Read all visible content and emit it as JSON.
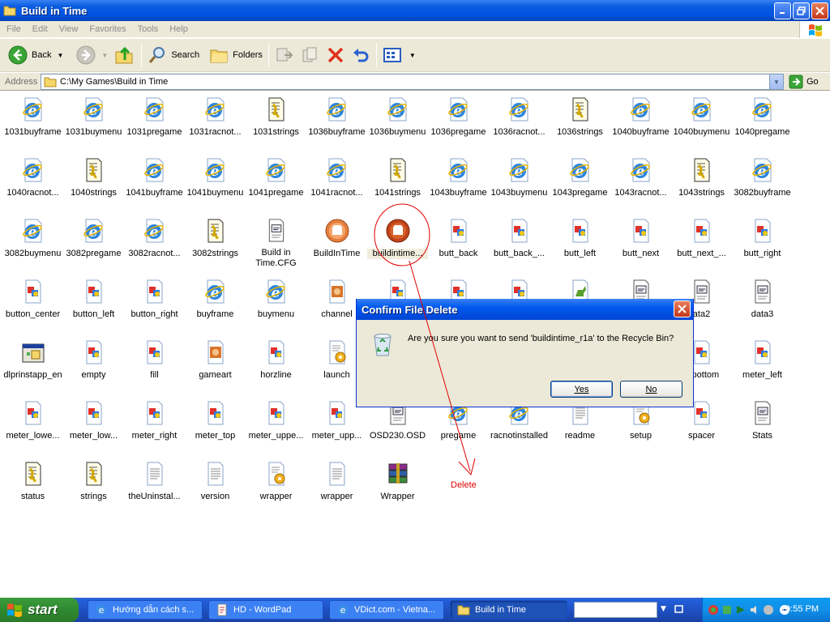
{
  "window": {
    "title": "Build in Time"
  },
  "menu": [
    "File",
    "Edit",
    "View",
    "Favorites",
    "Tools",
    "Help"
  ],
  "toolbar": {
    "back": "Back",
    "search": "Search",
    "folders": "Folders"
  },
  "address": {
    "label": "Address",
    "path": "C:\\My Games\\Build in Time",
    "go": "Go"
  },
  "files": [
    {
      "name": "1031buyframe",
      "icon": "ie-html"
    },
    {
      "name": "1031buymenu",
      "icon": "ie-html"
    },
    {
      "name": "1031pregame",
      "icon": "ie-html"
    },
    {
      "name": "1031racnot...",
      "icon": "ie-html"
    },
    {
      "name": "1031strings",
      "icon": "script-text"
    },
    {
      "name": "1036buyframe",
      "icon": "ie-html"
    },
    {
      "name": "1036buymenu",
      "icon": "ie-html"
    },
    {
      "name": "1036pregame",
      "icon": "ie-html"
    },
    {
      "name": "1036racnot...",
      "icon": "ie-html"
    },
    {
      "name": "1036strings",
      "icon": "script-text"
    },
    {
      "name": "1040buyframe",
      "icon": "ie-html"
    },
    {
      "name": "1040buymenu",
      "icon": "ie-html"
    },
    {
      "name": "1040pregame",
      "icon": "ie-html"
    },
    {
      "name": "1040racnot...",
      "icon": "ie-html"
    },
    {
      "name": "1040strings",
      "icon": "script-text"
    },
    {
      "name": "1041buyframe",
      "icon": "ie-html"
    },
    {
      "name": "1041buymenu",
      "icon": "ie-html"
    },
    {
      "name": "1041pregame",
      "icon": "ie-html"
    },
    {
      "name": "1041racnot...",
      "icon": "ie-html"
    },
    {
      "name": "1041strings",
      "icon": "script-text"
    },
    {
      "name": "1043buyframe",
      "icon": "ie-html"
    },
    {
      "name": "1043buymenu",
      "icon": "ie-html"
    },
    {
      "name": "1043pregame",
      "icon": "ie-html"
    },
    {
      "name": "1043racnot...",
      "icon": "ie-html"
    },
    {
      "name": "1043strings",
      "icon": "script-text"
    },
    {
      "name": "3082buyframe",
      "icon": "ie-html"
    },
    {
      "name": "3082buymenu",
      "icon": "ie-html"
    },
    {
      "name": "3082pregame",
      "icon": "ie-html"
    },
    {
      "name": "3082racnot...",
      "icon": "ie-html"
    },
    {
      "name": "3082strings",
      "icon": "script-text"
    },
    {
      "name": "Build in Time.CFG",
      "icon": "cfg-doc"
    },
    {
      "name": "BuildInTime",
      "icon": "app-orange"
    },
    {
      "name": "buildintime...",
      "icon": "app-orange-selected"
    },
    {
      "name": "butt_back",
      "icon": "image-doc"
    },
    {
      "name": "butt_back_...",
      "icon": "image-doc"
    },
    {
      "name": "butt_left",
      "icon": "image-doc"
    },
    {
      "name": "butt_next",
      "icon": "image-doc"
    },
    {
      "name": "butt_next_...",
      "icon": "image-doc"
    },
    {
      "name": "butt_right",
      "icon": "image-doc"
    },
    {
      "name": "button_center",
      "icon": "image-doc"
    },
    {
      "name": "button_left",
      "icon": "image-doc"
    },
    {
      "name": "button_right",
      "icon": "image-doc"
    },
    {
      "name": "buyframe",
      "icon": "ie-html"
    },
    {
      "name": "buymenu",
      "icon": "ie-html"
    },
    {
      "name": "channel",
      "icon": "media-doc"
    },
    {
      "name": "",
      "icon": "image-doc"
    },
    {
      "name": "",
      "icon": "image-doc"
    },
    {
      "name": "",
      "icon": "image-doc"
    },
    {
      "name": "",
      "icon": "dino-doc"
    },
    {
      "name": "",
      "icon": "cfg-doc"
    },
    {
      "name": "ata2",
      "icon": "cfg-doc"
    },
    {
      "name": "data3",
      "icon": "cfg-doc"
    },
    {
      "name": "dlprinstapp_en",
      "icon": "installer"
    },
    {
      "name": "empty",
      "icon": "image-doc"
    },
    {
      "name": "fill",
      "icon": "image-doc"
    },
    {
      "name": "gameart",
      "icon": "media-doc"
    },
    {
      "name": "horzline",
      "icon": "image-doc"
    },
    {
      "name": "launch",
      "icon": "settings-doc"
    },
    {
      "name": "",
      "icon": "blank"
    },
    {
      "name": "",
      "icon": "blank"
    },
    {
      "name": "",
      "icon": "blank"
    },
    {
      "name": "",
      "icon": "blank"
    },
    {
      "name": "",
      "icon": "blank"
    },
    {
      "name": "r_bottom",
      "icon": "image-doc"
    },
    {
      "name": "meter_left",
      "icon": "image-doc"
    },
    {
      "name": "meter_lowe...",
      "icon": "image-doc"
    },
    {
      "name": "meter_low...",
      "icon": "image-doc"
    },
    {
      "name": "meter_right",
      "icon": "image-doc"
    },
    {
      "name": "meter_top",
      "icon": "image-doc"
    },
    {
      "name": "meter_uppe...",
      "icon": "image-doc"
    },
    {
      "name": "meter_upp...",
      "icon": "image-doc"
    },
    {
      "name": "OSD230.OSD",
      "icon": "cfg-doc"
    },
    {
      "name": "pregame",
      "icon": "ie-html"
    },
    {
      "name": "racnotinstalled",
      "icon": "ie-html"
    },
    {
      "name": "readme",
      "icon": "text-doc"
    },
    {
      "name": "setup",
      "icon": "settings-doc"
    },
    {
      "name": "spacer",
      "icon": "image-doc"
    },
    {
      "name": "Stats",
      "icon": "cfg-doc"
    },
    {
      "name": "status",
      "icon": "script-text"
    },
    {
      "name": "strings",
      "icon": "script-text"
    },
    {
      "name": "theUninstal...",
      "icon": "text-doc"
    },
    {
      "name": "version",
      "icon": "text-doc"
    },
    {
      "name": "wrapper",
      "icon": "settings-doc"
    },
    {
      "name": "wrapper",
      "icon": "text-doc"
    },
    {
      "name": "Wrapper",
      "icon": "winrar"
    }
  ],
  "annotation": {
    "text": "Delete",
    "color": "#e00000"
  },
  "dialog": {
    "title": "Confirm File Delete",
    "message": "Are you sure you want to send 'buildintime_r1a' to the Recycle Bin?",
    "yes_label": "Yes",
    "no_label": "No"
  },
  "taskbar": {
    "start": "start",
    "tasks": [
      {
        "label": "Hướng dẫn cách s...",
        "icon": "ie-icon"
      },
      {
        "label": "HD - WordPad",
        "icon": "wordpad-icon"
      },
      {
        "label": "VDict.com - Vietna...",
        "icon": "ie-icon"
      },
      {
        "label": "Build in Time",
        "icon": "folder-icon",
        "active": true
      }
    ],
    "clock": "10:55 PM"
  },
  "colors": {
    "title_blue": "#0054e3",
    "chrome": "#ece9d8",
    "taskbar_blue": "#245edb",
    "start_green": "#2f8a2f"
  }
}
